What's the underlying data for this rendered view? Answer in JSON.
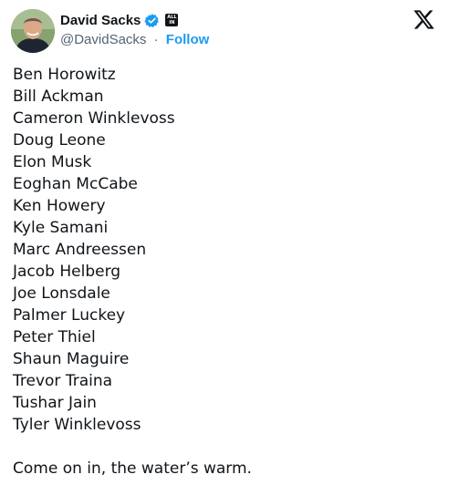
{
  "author": {
    "display_name": "David Sacks",
    "handle": "@DavidSacks",
    "separator": "·",
    "follow_label": "Follow",
    "affiliate_badge_line1": "ALL",
    "affiliate_badge_line2": "IN"
  },
  "icons": {
    "verified": "verified-badge-icon",
    "platform_logo": "x-logo-icon",
    "avatar": "avatar"
  },
  "colors": {
    "text": "#0f1419",
    "secondary_text": "#536471",
    "accent": "#1d9bf0"
  },
  "tweet": {
    "names": [
      "Ben Horowitz",
      "Bill Ackman",
      "Cameron Winklevoss",
      "Doug Leone",
      "Elon Musk",
      "Eoghan McCabe",
      "Ken Howery",
      "Kyle Samani",
      "Marc Andreessen",
      "Jacob Helberg",
      "Joe Lonsdale",
      "Palmer Luckey",
      "Peter Thiel",
      "Shaun Maguire",
      "Trevor Traina",
      "Tushar Jain",
      "Tyler Winklevoss"
    ],
    "closing": "Come on in, the water’s warm."
  }
}
